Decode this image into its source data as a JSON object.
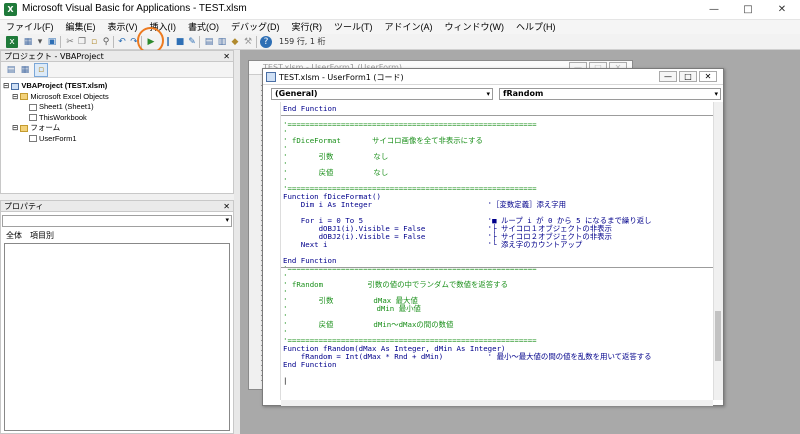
{
  "window": {
    "title": "Microsoft Visual Basic for Applications - TEST.xlsm",
    "app_icon_glyph": "X"
  },
  "menu": [
    "ファイル(F)",
    "編集(E)",
    "表示(V)",
    "挿入(I)",
    "書式(O)",
    "デバッグ(D)",
    "実行(R)",
    "ツール(T)",
    "アドイン(A)",
    "ウィンドウ(W)",
    "ヘルプ(H)"
  ],
  "toolbar": {
    "cursor_position": "159 行, 1 桁",
    "highlighted_button": "run-macro-button",
    "highlight_color": "#ec7a20"
  },
  "project_panel": {
    "title": "プロジェクト - VBAProject",
    "tree": [
      {
        "label": "VBAProject (TEST.xlsm)",
        "level": 0,
        "icon": "vba-project-icon",
        "bold": true
      },
      {
        "label": "Microsoft Excel Objects",
        "level": 1,
        "icon": "folder-icon"
      },
      {
        "label": "Sheet1 (Sheet1)",
        "level": 2,
        "icon": "sheet-icon"
      },
      {
        "label": "ThisWorkbook",
        "level": 2,
        "icon": "workbook-icon"
      },
      {
        "label": "フォーム",
        "level": 1,
        "icon": "folder-icon"
      },
      {
        "label": "UserForm1",
        "level": 2,
        "icon": "form-icon"
      }
    ]
  },
  "properties_panel": {
    "title": "プロパティ",
    "tabs": [
      "全体",
      "項目別"
    ]
  },
  "form_window": {
    "title": "TEST.xlsm - UserForm1 (UserForm)"
  },
  "code_window": {
    "title": "TEST.xlsm - UserForm1 (コード)",
    "object_dropdown": "(General)",
    "procedure_dropdown": "fRandom",
    "lines": [
      {
        "t": "End Function",
        "c": "kw"
      },
      {
        "t": "",
        "c": "tx"
      },
      {
        "t": "'========================================================",
        "c": "cm"
      },
      {
        "t": "'",
        "c": "cm"
      },
      {
        "t": "' fDiceFormat       サイコロ画像を全て非表示にする",
        "c": "cm"
      },
      {
        "t": "'",
        "c": "cm"
      },
      {
        "t": "'       引数         なし",
        "c": "cm"
      },
      {
        "t": "'",
        "c": "cm"
      },
      {
        "t": "'       戻値         なし",
        "c": "cm"
      },
      {
        "t": "'",
        "c": "cm"
      },
      {
        "t": "'========================================================",
        "c": "cm"
      },
      {
        "t": "Function fDiceFormat()",
        "c": "kw"
      },
      {
        "t": "    Dim i As Integer                          '［変数定義］添え字用",
        "c": "kw"
      },
      {
        "t": "",
        "c": "tx"
      },
      {
        "t": "    For i = 0 To 5                            '■ ループ i が 0 から 5 になるまで繰り返し",
        "c": "kw"
      },
      {
        "t": "        dOBJ1(i).Visible = False              '├ サイコロ１オブジェクトの非表示",
        "c": "kw"
      },
      {
        "t": "        dOBJ2(i).Visible = False              '├ サイコロ２オブジェクトの非表示",
        "c": "kw"
      },
      {
        "t": "    Next i                                    '└ 添え字のカウントアップ",
        "c": "kw"
      },
      {
        "t": "",
        "c": "tx"
      },
      {
        "t": "End Function",
        "c": "kw"
      },
      {
        "t": "'========================================================",
        "c": "cm"
      },
      {
        "t": "'",
        "c": "cm"
      },
      {
        "t": "' fRandom          引数の値の中でランダムで数値を返答する",
        "c": "cm"
      },
      {
        "t": "'",
        "c": "cm"
      },
      {
        "t": "'       引数         dMax 最大値",
        "c": "cm"
      },
      {
        "t": "'                    dMin 最小値",
        "c": "cm"
      },
      {
        "t": "'",
        "c": "cm"
      },
      {
        "t": "'       戻値         dMin〜dMaxの間の数値",
        "c": "cm"
      },
      {
        "t": "'",
        "c": "cm"
      },
      {
        "t": "'========================================================",
        "c": "cm"
      },
      {
        "t": "Function fRandom(dMax As Integer, dMin As Integer)",
        "c": "kw"
      },
      {
        "t": "    fRandom = Int(dMax * Rnd + dMin)          ' 最小〜最大値の間の値を乱数を用いて返答する",
        "c": "kw"
      },
      {
        "t": "End Function",
        "c": "kw"
      },
      {
        "t": "",
        "c": "tx"
      },
      {
        "t": "|",
        "c": "tx"
      }
    ],
    "divider_after": [
      0,
      19
    ]
  }
}
